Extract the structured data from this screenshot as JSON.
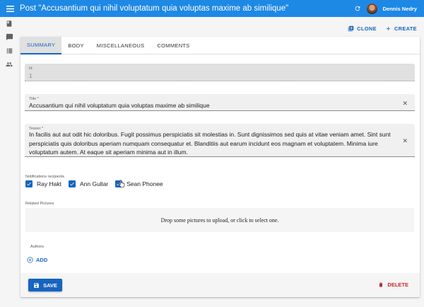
{
  "appbar": {
    "title": "Post \"Accusantium qui nihil voluptatum quia voluptas maxime ab similique\"",
    "user_name": "Dennis Nedry"
  },
  "sidebar": {
    "icons": [
      "book-icon",
      "comment-icon",
      "list-icon",
      "people-icon"
    ]
  },
  "actions": {
    "clone": "CLONE",
    "create": "CREATE"
  },
  "tabs": [
    "SUMMARY",
    "BODY",
    "MISCELLANEOUS",
    "COMMENTS"
  ],
  "active_tab": "SUMMARY",
  "form": {
    "id_label": "Id",
    "id_value": "1",
    "title_label": "Title *",
    "title_value": "Accusantium qui nihil voluptatum quia voluptas maxime ab similique",
    "teaser_label": "Teaser *",
    "teaser_value": "In facilis aut aut odit hic doloribus. Fugit possimus perspiciatis sit molestias in. Sunt dignissimos sed quis at vitae veniam amet. Sint sunt perspiciatis quis doloribus aperiam numquam consequatur et. Blanditiis aut earum incidunt eos magnam et voluptatem. Minima iure voluptatum autem. At eaque sit aperiam minima aut in illum.",
    "notifications_label": "Notifications recipients",
    "recipients": [
      {
        "name": "Ray Hakt",
        "checked": true
      },
      {
        "name": "Ann Gullar",
        "checked": true
      },
      {
        "name": "Sean Phonee",
        "checked": true
      }
    ],
    "pictures_label": "Related Pictures",
    "dropzone_text": "Drop some pictures to upload, or click to select one.",
    "authors_label": "Authors",
    "add_label": "ADD"
  },
  "footer": {
    "save_label": "SAVE",
    "delete_label": "DELETE"
  },
  "colors": {
    "appbar": "#1e88e5",
    "primary": "#1565c0",
    "danger": "#c62828"
  }
}
